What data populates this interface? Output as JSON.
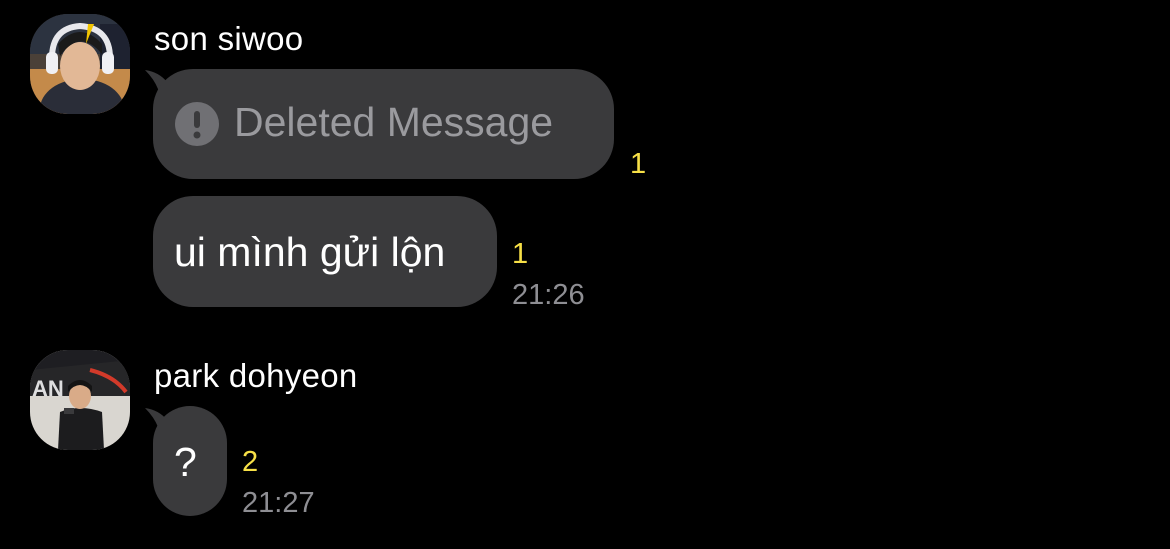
{
  "messages": [
    {
      "sender": "son siwoo",
      "bubbles": [
        {
          "deleted": true,
          "icon": "warning-circle-icon",
          "text": "Deleted Message",
          "unread": "1"
        },
        {
          "text": "ui mình gửi lộn",
          "unread": "1",
          "time": "21:26"
        }
      ]
    },
    {
      "sender": "park dohyeon",
      "bubbles": [
        {
          "text": "?",
          "unread": "2",
          "time": "21:27"
        }
      ]
    }
  ],
  "colors": {
    "background": "#000000",
    "bubble": "#3a3a3c",
    "unread": "#f7e047",
    "time": "#8e8e93",
    "deleted_text": "#9a9a9e"
  }
}
